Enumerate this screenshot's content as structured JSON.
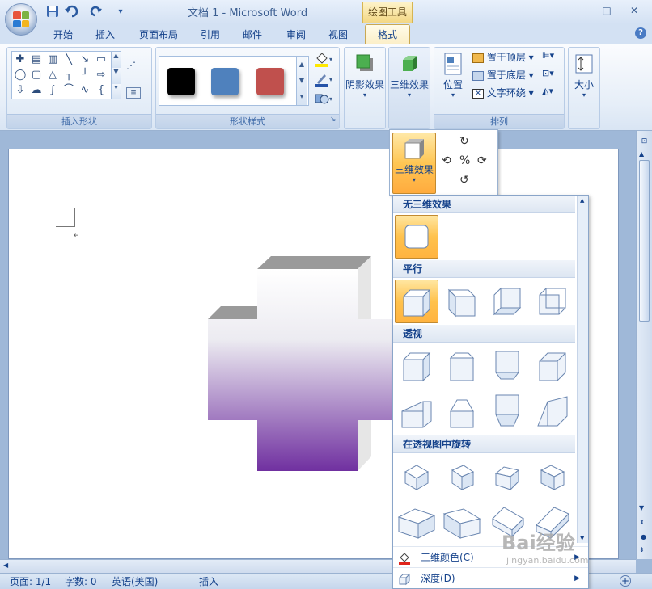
{
  "app": {
    "doc_title": "文档 1 - Microsoft Word",
    "context_tools": "绘图工具",
    "qat": {
      "save": "save-icon",
      "undo": "undo-icon",
      "redo": "redo-icon",
      "customize": "▾"
    },
    "window": {
      "minimize": "–",
      "restore": "□",
      "close": "✕"
    },
    "help": "?"
  },
  "tabs": [
    "开始",
    "插入",
    "页面布局",
    "引用",
    "邮件",
    "审阅",
    "视图"
  ],
  "active_tab": "格式",
  "ribbon": {
    "insert_shapes_label": "插入形状",
    "shape_styles_label": "形状样式",
    "shadow_label": "阴影效果",
    "three_d_label": "三维效果",
    "position_label": "位置",
    "bring_front": "置于顶层",
    "send_back": "置于底层",
    "text_wrap": "文字环绕",
    "arrange_label": "排列",
    "size_label": "大小",
    "style_colors": [
      "#000000",
      "#4f81bd",
      "#c0504d"
    ]
  },
  "popup": {
    "three_d_label": "三维效果"
  },
  "dropdown": {
    "sections": [
      "无三维效果",
      "平行",
      "透视",
      "在透视图中旋转"
    ],
    "menu": [
      {
        "label": "三维颜色(C)",
        "icon": "paint-bucket-icon"
      },
      {
        "label": "深度(D)",
        "icon": "depth-icon"
      }
    ]
  },
  "status": {
    "page": "页面: 1/1",
    "words": "字数: 0",
    "language": "英语(美国)",
    "mode": "插入"
  },
  "watermark": {
    "brand": "Bai经验",
    "url": "jingyan.baidu.com"
  }
}
